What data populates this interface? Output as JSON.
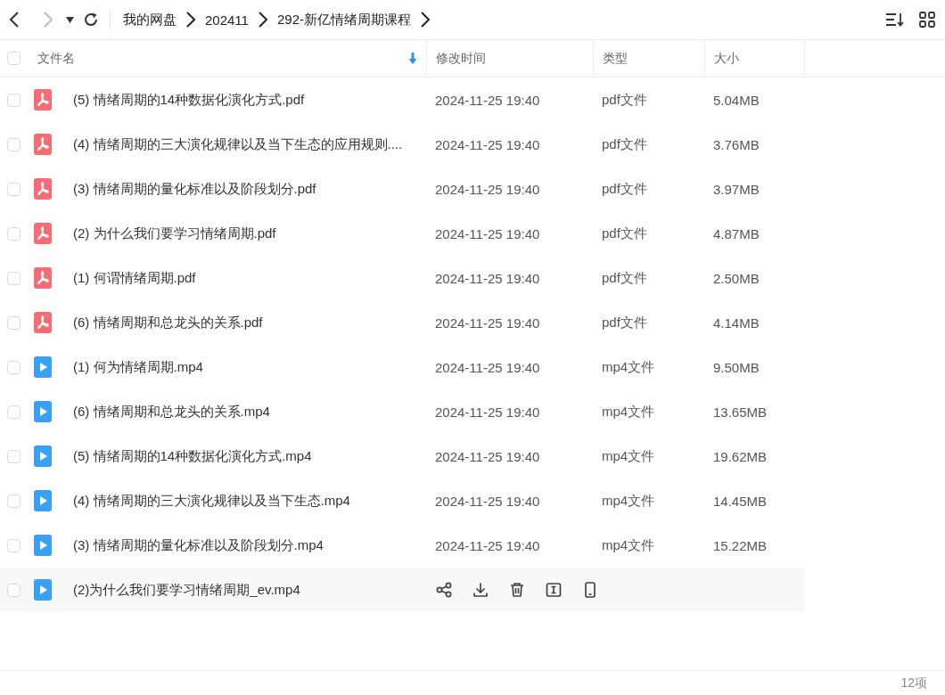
{
  "nav": {
    "back_enabled": true,
    "forward_enabled": false
  },
  "breadcrumb": [
    "我的网盘",
    "202411",
    "292-新亿情绪周期课程"
  ],
  "table": {
    "columns": [
      {
        "label": "文件名",
        "sorted": true
      },
      {
        "label": "修改时间",
        "sorted": false
      },
      {
        "label": "类型",
        "sorted": false
      },
      {
        "label": "大小",
        "sorted": false
      }
    ],
    "all_checked": false,
    "rows": [
      {
        "kind": "pdf",
        "name": "(5) 情绪周期的14种数据化演化方式.pdf",
        "modified": "2024-11-25 19:40",
        "type": "pdf文件",
        "size": "5.04MB",
        "checked": false,
        "hovered": false
      },
      {
        "kind": "pdf",
        "name": "(4) 情绪周期的三大演化规律以及当下生态的应用规则....",
        "modified": "2024-11-25 19:40",
        "type": "pdf文件",
        "size": "3.76MB",
        "checked": false,
        "hovered": false
      },
      {
        "kind": "pdf",
        "name": "(3) 情绪周期的量化标准以及阶段划分.pdf",
        "modified": "2024-11-25 19:40",
        "type": "pdf文件",
        "size": "3.97MB",
        "checked": false,
        "hovered": false
      },
      {
        "kind": "pdf",
        "name": "(2) 为什么我们要学习情绪周期.pdf",
        "modified": "2024-11-25 19:40",
        "type": "pdf文件",
        "size": "4.87MB",
        "checked": false,
        "hovered": false
      },
      {
        "kind": "pdf",
        "name": "(1) 何谓情绪周期.pdf",
        "modified": "2024-11-25 19:40",
        "type": "pdf文件",
        "size": "2.50MB",
        "checked": false,
        "hovered": false
      },
      {
        "kind": "pdf",
        "name": "(6) 情绪周期和总龙头的关系.pdf",
        "modified": "2024-11-25 19:40",
        "type": "pdf文件",
        "size": "4.14MB",
        "checked": false,
        "hovered": false
      },
      {
        "kind": "mp4",
        "name": "(1) 何为情绪周期.mp4",
        "modified": "2024-11-25 19:40",
        "type": "mp4文件",
        "size": "9.50MB",
        "checked": false,
        "hovered": false
      },
      {
        "kind": "mp4",
        "name": "(6) 情绪周期和总龙头的关系.mp4",
        "modified": "2024-11-25 19:40",
        "type": "mp4文件",
        "size": "13.65MB",
        "checked": false,
        "hovered": false
      },
      {
        "kind": "mp4",
        "name": "(5) 情绪周期的14种数据化演化方式.mp4",
        "modified": "2024-11-25 19:40",
        "type": "mp4文件",
        "size": "19.62MB",
        "checked": false,
        "hovered": false
      },
      {
        "kind": "mp4",
        "name": "(4) 情绪周期的三大演化规律以及当下生态.mp4",
        "modified": "2024-11-25 19:40",
        "type": "mp4文件",
        "size": "14.45MB",
        "checked": false,
        "hovered": false
      },
      {
        "kind": "mp4",
        "name": "(3) 情绪周期的量化标准以及阶段划分.mp4",
        "modified": "2024-11-25 19:40",
        "type": "mp4文件",
        "size": "15.22MB",
        "checked": false,
        "hovered": false
      },
      {
        "kind": "mp4",
        "name": "(2)为什么我们要学习情绪周期_ev.mp4",
        "checked": false,
        "hovered": true
      }
    ]
  },
  "status_bar": {
    "count": "12项"
  }
}
